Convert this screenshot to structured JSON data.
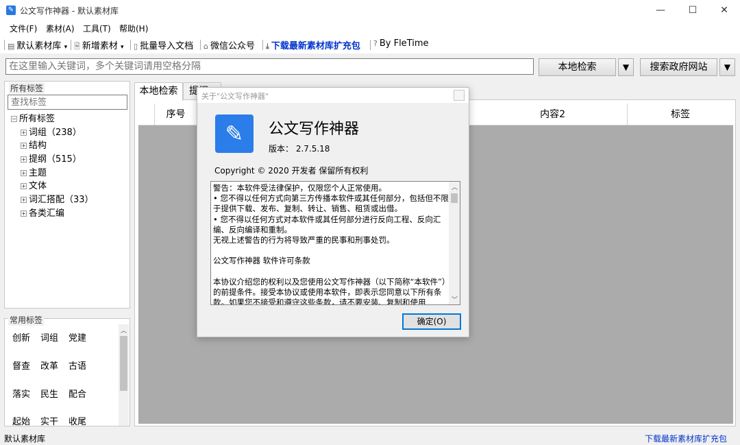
{
  "window": {
    "title": "公文写作神器 - 默认素材库",
    "app_icon": "pencil-icon",
    "minimize": "—",
    "maximize": "☐",
    "close": "✕"
  },
  "menu": [
    "文件(F)",
    "素材(A)",
    "工具(T)",
    "帮助(H)"
  ],
  "toolbar": {
    "library": "默认素材库",
    "library_arrow": "▾",
    "add_material": "新增素材",
    "add_arrow": "▾",
    "batch_import": "批量导入文档",
    "wechat": "微信公众号",
    "download": "下载最新素材库扩充包",
    "by": "By FleTime"
  },
  "search": {
    "placeholder": "在这里输入关键词，多个关键词请用空格分隔",
    "local_search": "本地检索",
    "gov_search": "搜索政府网站",
    "dropdown": "▼"
  },
  "left": {
    "group_label": "所有标签",
    "tag_search_placeholder": "查找标签",
    "root": "所有标签",
    "items": [
      "词组（238）",
      "结构",
      "提纲（515）",
      "主题",
      "文体",
      "词汇搭配（33）",
      "各类汇编"
    ]
  },
  "common": {
    "group_label": "常用标签",
    "tags": [
      "创新",
      "词组",
      "党建",
      "督查",
      "改革",
      "古语",
      "落实",
      "民生",
      "配合",
      "起始",
      "实干",
      "收尾"
    ]
  },
  "tabs": [
    "本地检索",
    "提纲"
  ],
  "grid": {
    "col_index": "序号",
    "col_content2": "内容2",
    "col_tags": "标签"
  },
  "status": {
    "left": "默认素材库",
    "right_link": "下载最新素材库扩充包"
  },
  "dialog": {
    "title": "关于\"公文写作神器\"",
    "app_name": "公文写作神器",
    "version": "版本： 2.7.5.18",
    "copyright": "Copyright © 2020  开发者 保留所有权利",
    "license": "警告：本软件受法律保护，仅限您个人正常使用。\n• 您不得以任何方式向第三方传播本软件或其任何部分，包括但不限于提供下载、发布、复制、转让、销售、租赁或出借。\n• 您不得以任何方式对本软件或其任何部分进行反向工程、反向汇编、反向编译和重制。\n无视上述警告的行为将导致严重的民事和刑事处罚。\n\n公文写作神器 软件许可条款\n\n本协议介绍您的权利以及您使用公文写作神器（以下简称“本软件”）的前提条件。接受本协议或使用本软件，即表示您同意以下所有条款。如果您不接受和遵守这些条款，请不要安装、复制和使用",
    "ok": "确定(O)"
  }
}
